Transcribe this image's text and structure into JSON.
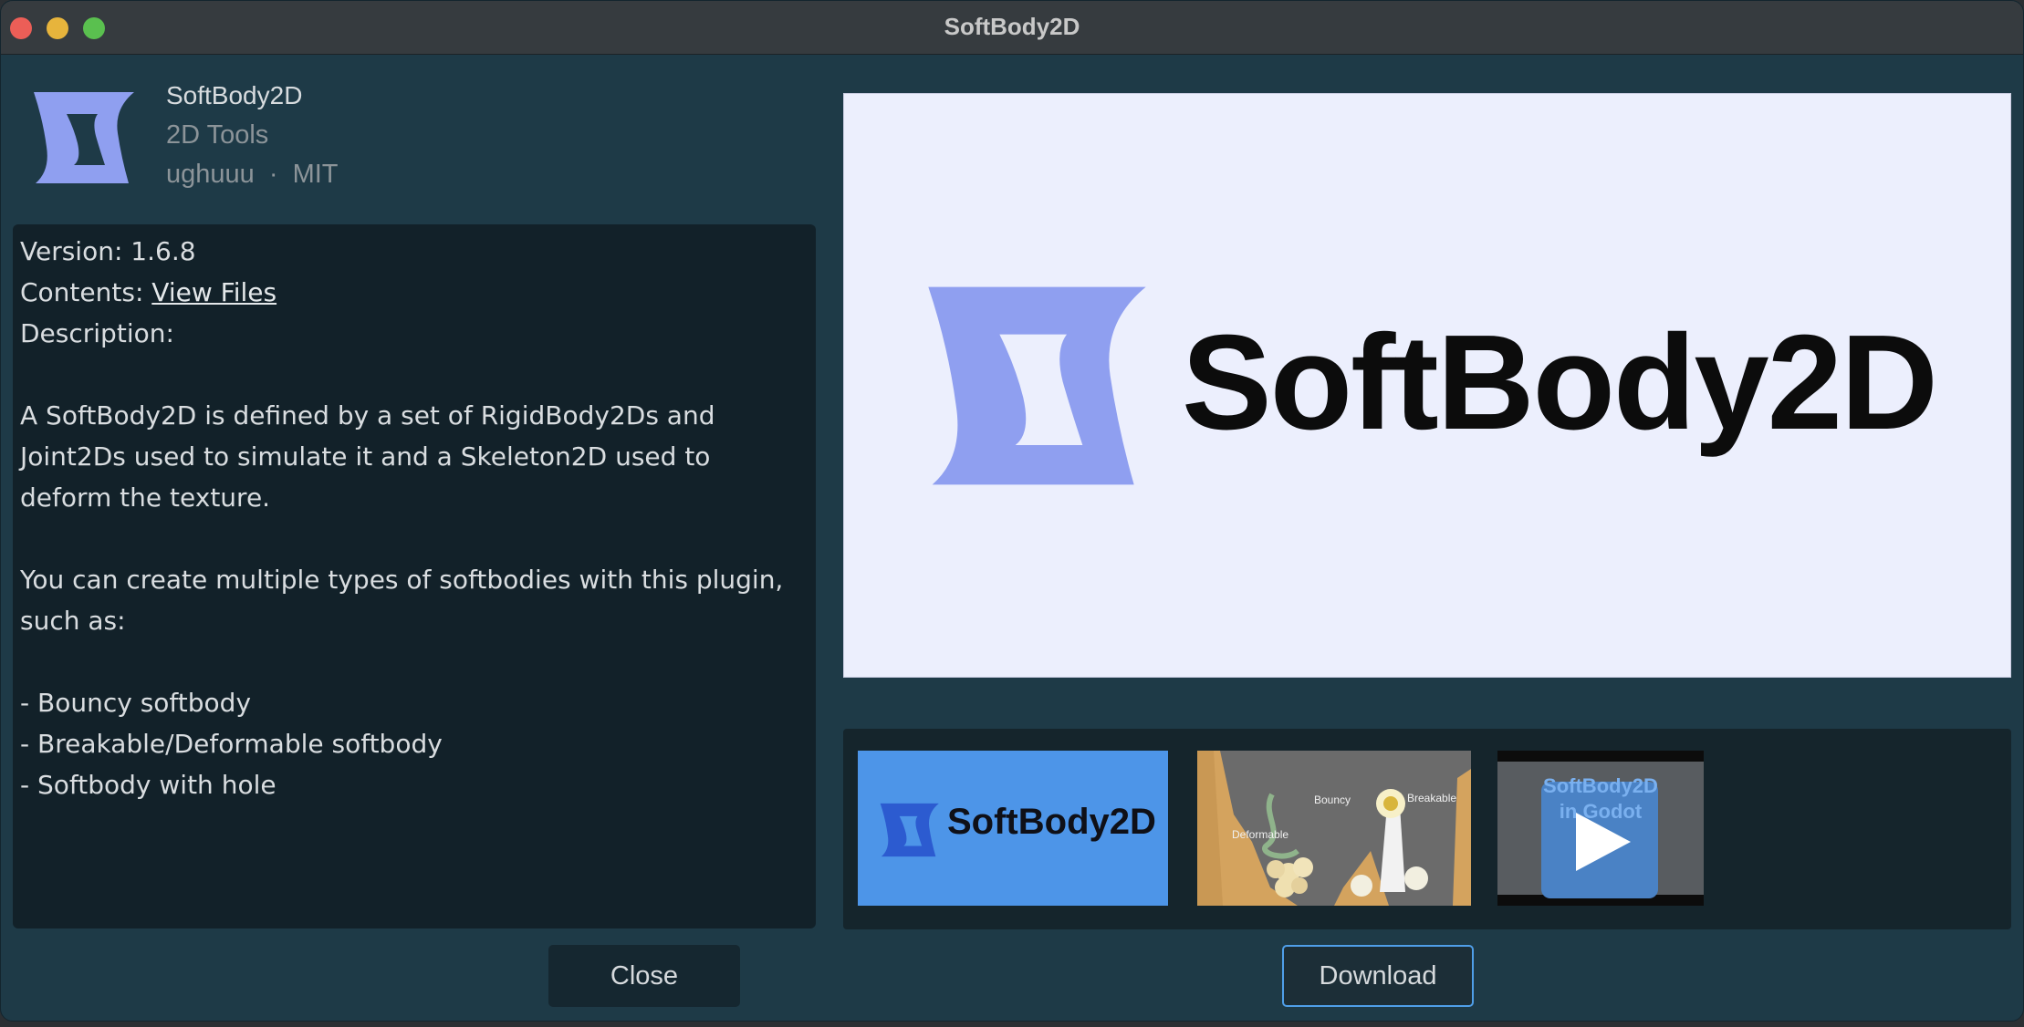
{
  "window": {
    "title": "SoftBody2D"
  },
  "asset": {
    "name": "SoftBody2D",
    "category": "2D Tools",
    "author": "ughuuu",
    "separator": "·",
    "license": "MIT"
  },
  "details": {
    "version_line": "Version: 1.6.8",
    "contents_label": "Contents: ",
    "contents_link": "View Files",
    "description_label": "Description:",
    "paragraph1": "A SoftBody2D is defined by a set of RigidBody2Ds and Joint2Ds used to simulate it and a Skeleton2D used to deform the texture.",
    "paragraph2": "You can create multiple types of softbodies with this plugin, such as:",
    "bullets": [
      "- Bouncy softbody",
      "- Breakable/Deformable softbody",
      "- Softbody with hole"
    ]
  },
  "preview": {
    "logo_text": "SoftBody2D",
    "logo_color": "#8f9ff0",
    "background": "#eceffd"
  },
  "thumbnails": [
    {
      "kind": "image",
      "text": "SoftBody2D"
    },
    {
      "kind": "image",
      "labels": [
        "Bouncy",
        "Breakable",
        "Deformable"
      ]
    },
    {
      "kind": "video",
      "caption_line1": "SoftBody2D",
      "caption_line2": "in Godot",
      "icon": "play-icon"
    }
  ],
  "buttons": {
    "close": "Close",
    "download": "Download"
  },
  "colors": {
    "accent": "#4f9ee8",
    "panel_bg": "#1e3a47"
  }
}
